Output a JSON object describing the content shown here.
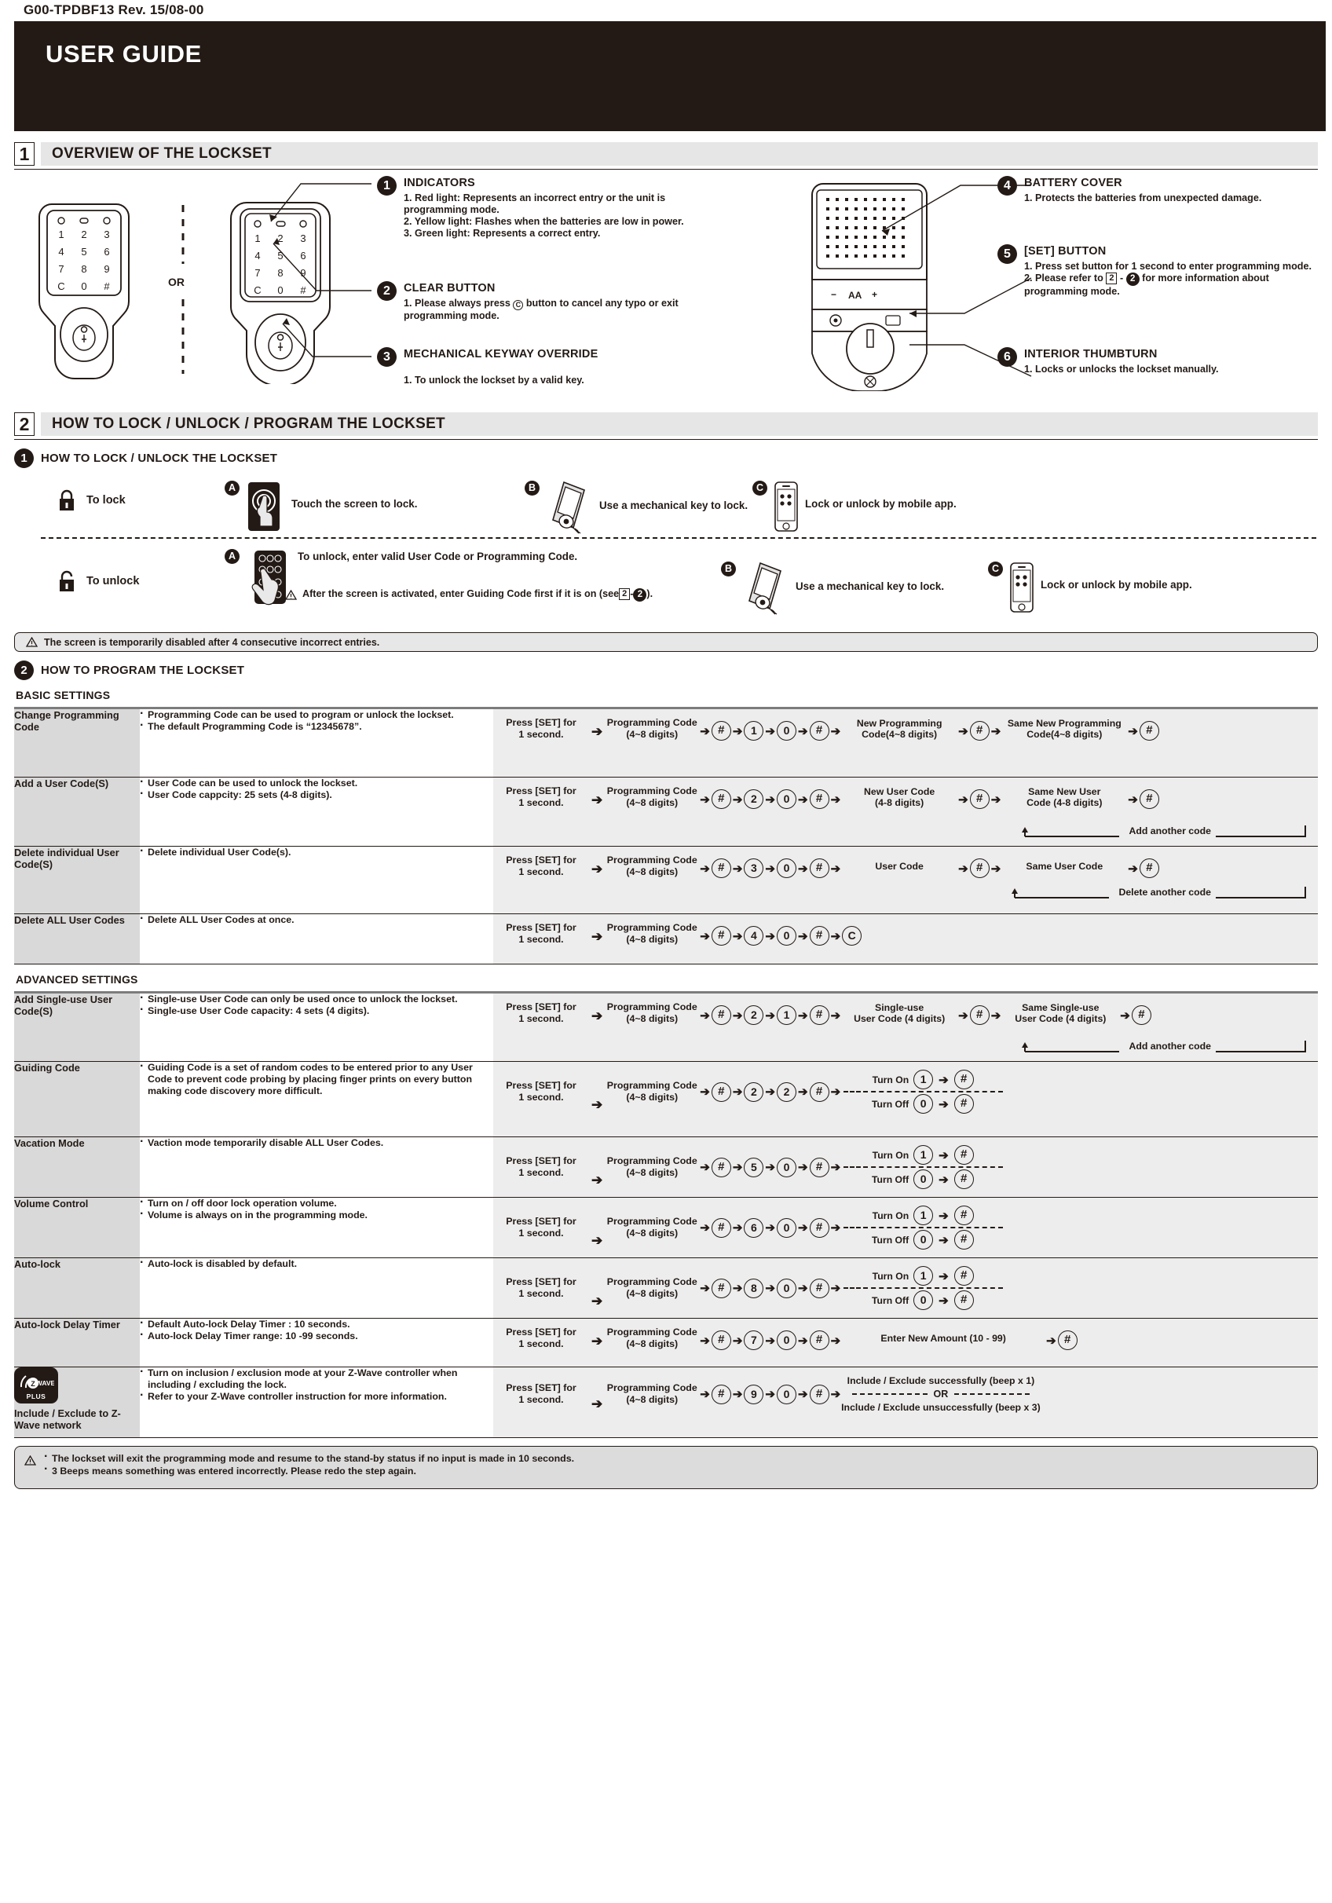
{
  "doc": {
    "reference": "G00-TPDBF13   Rev. 15/08-00",
    "title": "USER GUIDE"
  },
  "sections": [
    {
      "num": "1",
      "title": "OVERVIEW OF THE LOCKSET"
    },
    {
      "num": "2",
      "title": "HOW TO LOCK / UNLOCK / PROGRAM THE LOCKSET"
    }
  ],
  "overview": {
    "or_label": "OR",
    "callouts": [
      {
        "num": "1",
        "title": "INDICATORS",
        "lines": [
          "1. Red light: Represents an incorrect entry or the unit is",
          "     programming mode.",
          "2. Yellow light: Flashes when the batteries are low in power.",
          "3. Green light: Represents a correct entry."
        ]
      },
      {
        "num": "2",
        "title": "CLEAR BUTTON",
        "lines_pre": "1. Please always press",
        "lines_post": "button to cancel any typo or exit",
        "lines_cont": "     programming mode.",
        "glyph": "C"
      },
      {
        "num": "3",
        "title": "MECHANICAL KEYWAY OVERRIDE",
        "lines": [
          "1. To unlock the lockset by a valid key."
        ]
      },
      {
        "num": "4",
        "title": "BATTERY COVER",
        "lines": [
          "1. Protects the batteries from unexpected damage."
        ]
      },
      {
        "num": "5",
        "title": "[SET] BUTTON",
        "line1": "1. Press set button for 1 second to enter programming mode.",
        "line2_pre": "2. Please refer to",
        "line2_box": "2",
        "line2_dash": "-",
        "line2_circle": "2",
        "line2_post": "for more information about",
        "line3": "     programming mode."
      },
      {
        "num": "6",
        "title": "INTERIOR THUMBTURN",
        "lines": [
          "1. Locks or unlocks the lockset manually."
        ]
      }
    ],
    "keypad": {
      "row1": [
        "1",
        "2",
        "3"
      ],
      "row2": [
        "4",
        "5",
        "6"
      ],
      "row3": [
        "7",
        "8",
        "9"
      ],
      "row4": [
        "C",
        "0",
        "#"
      ]
    },
    "battery_label": "AA"
  },
  "lock_unlock": {
    "subhead_num": "1",
    "subhead": "HOW TO LOCK / UNLOCK THE LOCKSET",
    "to_lock_label": "To lock",
    "to_unlock_label": "To unlock",
    "lock_options": [
      {
        "key": "A",
        "text": "Touch the screen to lock."
      },
      {
        "key": "B",
        "text": "Use a mechanical key to lock."
      },
      {
        "key": "C",
        "text": "Lock or unlock by mobile app."
      }
    ],
    "unlock_options": [
      {
        "key": "A",
        "text": "To unlock, enter valid User Code or Programming Code."
      },
      {
        "key": "B",
        "text": "Use a mechanical key to lock."
      },
      {
        "key": "C",
        "text": "Lock or unlock by mobile app."
      }
    ],
    "unlock_note_pre": "After the screen is activated, enter Guiding Code first if it is on (see",
    "unlock_note_box": "2",
    "unlock_note_dash": "-",
    "unlock_note_circle": "2",
    "unlock_note_post": ").",
    "screen_warning": "The screen is temporarily disabled after 4 consecutive incorrect entries."
  },
  "program": {
    "subhead_num": "2",
    "subhead": "HOW TO PROGRAM THE LOCKSET",
    "basic_label": "BASIC SETTINGS",
    "advanced_label": "ADVANCED SETTINGS",
    "press_set": "Press [SET] for\n1 second.",
    "press_set_l1": "Press [SET] for",
    "press_set_l2": "1 second.",
    "prog_code_l1": "Programming Code",
    "prog_code_l2": "(4~8 digits)"
  },
  "basic_rows": [
    {
      "name": "Change Programming Code",
      "desc": [
        "Programming Code can be used to program or unlock the lockset.",
        "The default Programming Code is “12345678”."
      ],
      "desc_bold": "12345678",
      "keys": [
        "#",
        "1",
        "0",
        "#"
      ],
      "mid_label_l1": "New Programming",
      "mid_label_l2": "Code(4~8 digits)",
      "end_label_l1": "Same New Programming",
      "end_label_l2": "Code(4~8 digits)",
      "loop": null
    },
    {
      "name": "Add a User Code(S)",
      "desc": [
        "User Code can be used to unlock the lockset.",
        "User Code cappcity: 25 sets (4-8 digits)."
      ],
      "keys": [
        "#",
        "2",
        "0",
        "#"
      ],
      "mid_label_l1": "New User Code",
      "mid_label_l2": "(4-8 digits)",
      "end_label_l1": "Same New User",
      "end_label_l2": "Code (4-8 digits)",
      "loop": "Add another code"
    },
    {
      "name": "Delete individual User Code(S)",
      "desc": [
        "Delete individual User Code(s)."
      ],
      "keys": [
        "#",
        "3",
        "0",
        "#"
      ],
      "mid_label_l1": "User Code",
      "mid_label_l2": "",
      "end_label_l1": "Same User Code",
      "end_label_l2": "",
      "loop": "Delete another code"
    },
    {
      "name": "Delete ALL User Codes",
      "desc": [
        "Delete ALL User Codes at once."
      ],
      "keys": [
        "#",
        "4",
        "0",
        "#",
        "C"
      ],
      "mid_label_l1": "",
      "mid_label_l2": "",
      "end_label_l1": "",
      "end_label_l2": "",
      "loop": null
    }
  ],
  "advanced_rows": [
    {
      "name": "Add Single-use User Code(S)",
      "desc": [
        "Single-use User Code can only be used once to unlock the lockset.",
        "Single-use User Code capacity: 4 sets (4 digits)."
      ],
      "keys": [
        "#",
        "2",
        "1",
        "#"
      ],
      "mid_label_l1": "Single-use",
      "mid_label_l2": "User Code (4 digits)",
      "end_label_l1": "Same Single-use",
      "end_label_l2": "User Code (4 digits)",
      "loop": "Add another code",
      "style": "codes"
    },
    {
      "name": "Guiding Code",
      "desc": [
        "Guiding Code is a set of random codes to be entered prior to any User Code to prevent code probing by placing finger prints on every button making code discovery more difficult."
      ],
      "keys": [
        "#",
        "2",
        "2",
        "#"
      ],
      "style": "onoff",
      "turn_on": "Turn On",
      "turn_off": "Turn Off",
      "on_keys": [
        "1",
        "#"
      ],
      "off_keys": [
        "0",
        "#"
      ]
    },
    {
      "name": "Vacation Mode",
      "desc": [
        "Vaction mode temporarily disable ALL User Codes."
      ],
      "keys": [
        "#",
        "5",
        "0",
        "#"
      ],
      "style": "onoff",
      "turn_on": "Turn On",
      "turn_off": "Turn Off",
      "on_keys": [
        "1",
        "#"
      ],
      "off_keys": [
        "0",
        "#"
      ]
    },
    {
      "name": "Volume Control",
      "desc": [
        "Turn on / off door lock operation volume.",
        "Volume is always on in the programming mode."
      ],
      "keys": [
        "#",
        "6",
        "0",
        "#"
      ],
      "style": "onoff",
      "turn_on": "Turn On",
      "turn_off": "Turn Off",
      "on_keys": [
        "1",
        "#"
      ],
      "off_keys": [
        "0",
        "#"
      ]
    },
    {
      "name": "Auto-lock",
      "desc": [
        "Auto-lock is disabled by default."
      ],
      "keys": [
        "#",
        "8",
        "0",
        "#"
      ],
      "style": "onoff",
      "turn_on": "Turn On",
      "turn_off": "Turn Off",
      "on_keys": [
        "1",
        "#"
      ],
      "off_keys": [
        "0",
        "#"
      ]
    },
    {
      "name": "Auto-lock Delay Timer",
      "desc": [
        "Default Auto-lock Delay Timer : 10 seconds.",
        "Auto-lock Delay Timer range: 10 -99 seconds."
      ],
      "keys": [
        "#",
        "7",
        "0",
        "#"
      ],
      "style": "amount",
      "amount_label": "Enter New Amount (10 - 99)",
      "end_key": "#"
    },
    {
      "name": "Include / Exclude to Z-Wave network",
      "desc": [
        "Turn on inclusion / exclusion mode at your Z-Wave controller when including / excluding the lock.",
        "Refer to your Z-Wave controller instruction for more information."
      ],
      "keys": [
        "#",
        "9",
        "0",
        "#"
      ],
      "style": "zwave",
      "zwave_badge": "WAVE",
      "zwave_plus": "PLUS",
      "result_success": "Include / Exclude successfully (beep x 1)",
      "result_or": "OR",
      "result_fail": "Include / Exclude unsuccessfully (beep x 3)"
    }
  ],
  "footer": {
    "notes": [
      "The lockset will exit the programming mode and resume to the stand-by status if no input is made in 10 seconds.",
      "3 Beeps means something was entered incorrectly. Please redo the step again."
    ]
  },
  "colors": {
    "dark": "#231a16",
    "section_bar": "#e6e6e6",
    "name_cell": "#d9d9d9",
    "step_cell": "#ededed",
    "footer_bg": "#dcdcdc"
  }
}
